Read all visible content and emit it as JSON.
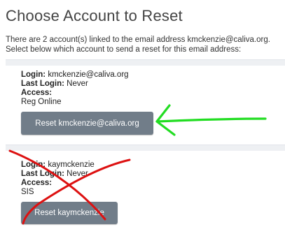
{
  "page": {
    "title": "Choose Account to Reset",
    "intro_line_1": "There are 2 account(s) linked to the email address kmckenzie@caliva.org.",
    "intro_line_2": "Select below which account to send a reset for this email address:"
  },
  "labels": {
    "login": "Login:",
    "last_login": "Last Login:",
    "access": "Access:"
  },
  "accounts": [
    {
      "login": "kmckenzie@caliva.org",
      "last_login": "Never",
      "access": "Reg Online",
      "reset_label": "Reset kmckenzie@caliva.org"
    },
    {
      "login": "kaymckenzie",
      "last_login": "Never",
      "access": "SIS",
      "reset_label": "Reset kaymckenzie"
    }
  ],
  "annotations": {
    "arrow_color": "#22dd22",
    "cross_color": "#dd1111"
  },
  "colors": {
    "button_bg": "#717d89",
    "title_text": "#444444"
  }
}
